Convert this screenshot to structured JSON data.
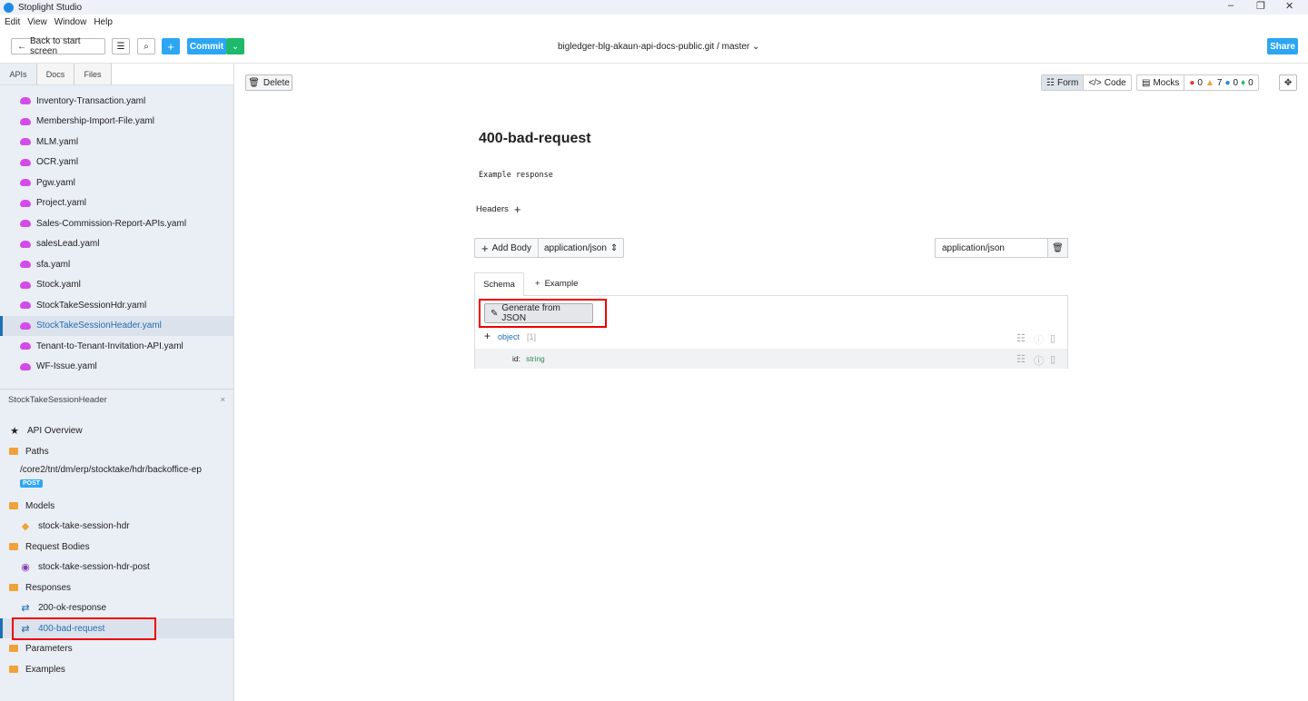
{
  "app": {
    "title": "Stoplight Studio",
    "menu": [
      "Edit",
      "View",
      "Window",
      "Help"
    ]
  },
  "toolbar": {
    "back": "Back to start screen",
    "commit": "Commit",
    "repo": "bigledger-blg-akaun-api-docs-public.git",
    "branch": "master",
    "share": "Share"
  },
  "sidebar": {
    "tabs": [
      "APIs",
      "Docs",
      "Files"
    ],
    "files": [
      "Inventory-Transaction.yaml",
      "Membership-Import-File.yaml",
      "MLM.yaml",
      "OCR.yaml",
      "Pgw.yaml",
      "Project.yaml",
      "Sales-Commission-Report-APIs.yaml",
      "salesLead.yaml",
      "sfa.yaml",
      "Stock.yaml",
      "StockTakeSessionHdr.yaml",
      "StockTakeSessionHeader.yaml",
      "Tenant-to-Tenant-Invitation-API.yaml",
      "WF-Issue.yaml"
    ],
    "project": "StockTakeSessionHeader",
    "tree": {
      "overview": "API Overview",
      "paths": "Paths",
      "path": "/core2/tnt/dm/erp/stocktake/hdr/backoffice-ep",
      "method": "POST",
      "models": "Models",
      "model": "stock-take-session-hdr",
      "request_bodies": "Request Bodies",
      "request_body": "stock-take-session-hdr-post",
      "responses": "Responses",
      "response1": "200-ok-response",
      "response2": "400-bad-request",
      "parameters": "Parameters",
      "examples": "Examples"
    }
  },
  "editor": {
    "delete": "Delete",
    "form": "Form",
    "code": "Code",
    "mocks": "Mocks",
    "counts": {
      "errors": "0",
      "warnings": "7",
      "info": "0",
      "hints": "0"
    },
    "title": "400-bad-request",
    "description": "Example response",
    "headers": "Headers",
    "add_body": "Add Body",
    "content_type": "application/json",
    "content_type_input": "application/json",
    "tabs": {
      "schema": "Schema",
      "example": "Example"
    },
    "generate": "Generate from JSON",
    "schema": {
      "root_type": "object",
      "root_count": "[1]",
      "prop_name": "id:",
      "prop_type": "string"
    }
  }
}
